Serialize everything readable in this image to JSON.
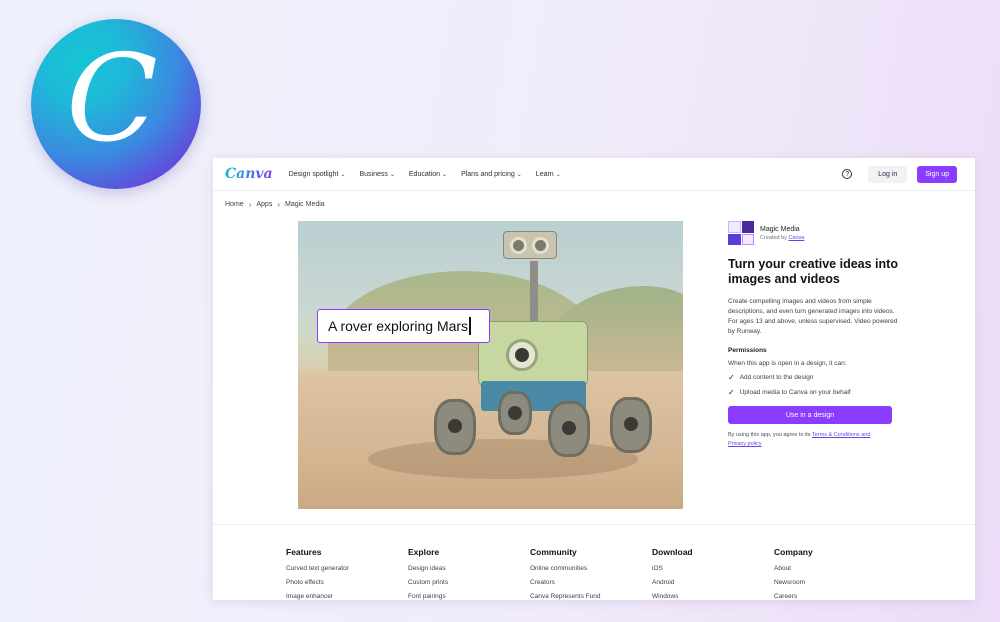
{
  "logo": {
    "letter": "C"
  },
  "nav": {
    "brand": "Canva",
    "items": [
      {
        "label": "Design spotlight"
      },
      {
        "label": "Business"
      },
      {
        "label": "Education"
      },
      {
        "label": "Plans and pricing"
      },
      {
        "label": "Learn"
      }
    ],
    "help": "?",
    "login": "Log in",
    "signup": "Sign up"
  },
  "breadcrumb": [
    "Home",
    "Apps",
    "Magic Media"
  ],
  "hero": {
    "prompt": "A rover exploring Mars"
  },
  "app": {
    "name": "Magic Media",
    "created_by_prefix": "Created by",
    "created_by_link": "Canva",
    "headline": "Turn your creative ideas into images and videos",
    "description": "Create compelling images and videos from simple descriptions, and even turn generated images into videos. For ages 13 and above, unless supervised. Video powered by Runway.",
    "permissions_title": "Permissions",
    "permissions_intro": "When this app is open in a design, it can:",
    "permissions": [
      "Add content to the design",
      "Upload media to Canva on your behalf"
    ],
    "use_button": "Use in a design",
    "terms_prefix": "By using this app, you agree to its",
    "terms_link1": "Terms & Conditions and",
    "terms_link2": "Privacy policy"
  },
  "footer": {
    "columns": [
      {
        "title": "Features",
        "links": [
          "Curved text generator",
          "Photo effects",
          "Image enhancer"
        ]
      },
      {
        "title": "Explore",
        "links": [
          "Design ideas",
          "Custom prints",
          "Font pairings"
        ]
      },
      {
        "title": "Community",
        "links": [
          "Online communities",
          "Creators",
          "Canva Represents Fund"
        ]
      },
      {
        "title": "Download",
        "links": [
          "iOS",
          "Android",
          "Windows"
        ]
      },
      {
        "title": "Company",
        "links": [
          "About",
          "Newsroom",
          "Careers"
        ]
      }
    ]
  },
  "colors": {
    "accent": "#8b3dff",
    "link": "#6b44e0"
  }
}
